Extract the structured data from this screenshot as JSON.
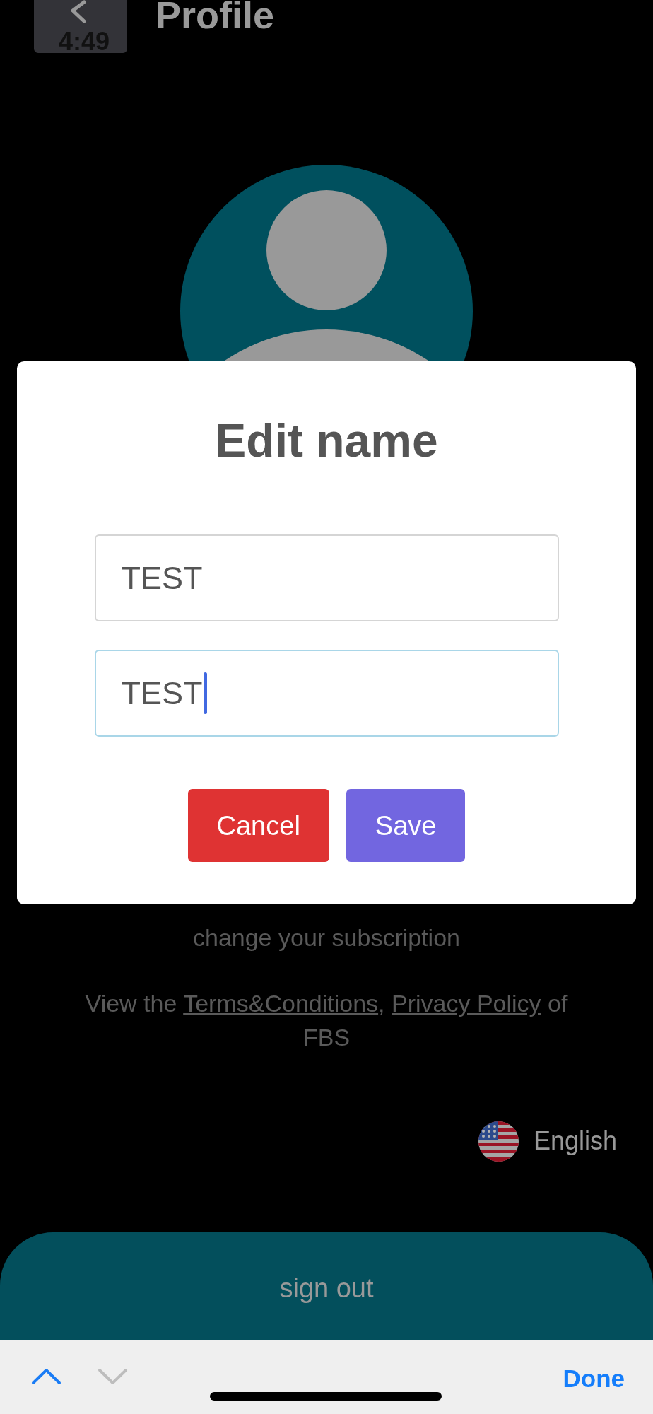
{
  "header": {
    "time": "4:49",
    "title": "Profile"
  },
  "subscription_note": "change your subscription",
  "legal_note": [
    {
      "kind": "text",
      "text": "View the "
    },
    {
      "kind": "link",
      "text": "Terms&Conditions"
    },
    {
      "kind": "text",
      "text": ", "
    },
    {
      "kind": "link",
      "text": "Privacy Policy"
    },
    {
      "kind": "text",
      "text": " of FBS"
    }
  ],
  "language": {
    "label": "English"
  },
  "sign_out": {
    "label": "sign out"
  },
  "dialog": {
    "title": "Edit name",
    "fields": [
      {
        "value": "TEST",
        "focused": false
      },
      {
        "value": "TEST",
        "focused": true
      }
    ],
    "buttons": [
      {
        "kind": "cancel",
        "label": "Cancel"
      },
      {
        "kind": "save",
        "label": "Save"
      }
    ]
  },
  "keyboard_toolbar": {
    "arrows": [
      {
        "kind": "up",
        "disabled": false
      },
      {
        "kind": "down",
        "disabled": true
      }
    ],
    "done": "Done"
  }
}
